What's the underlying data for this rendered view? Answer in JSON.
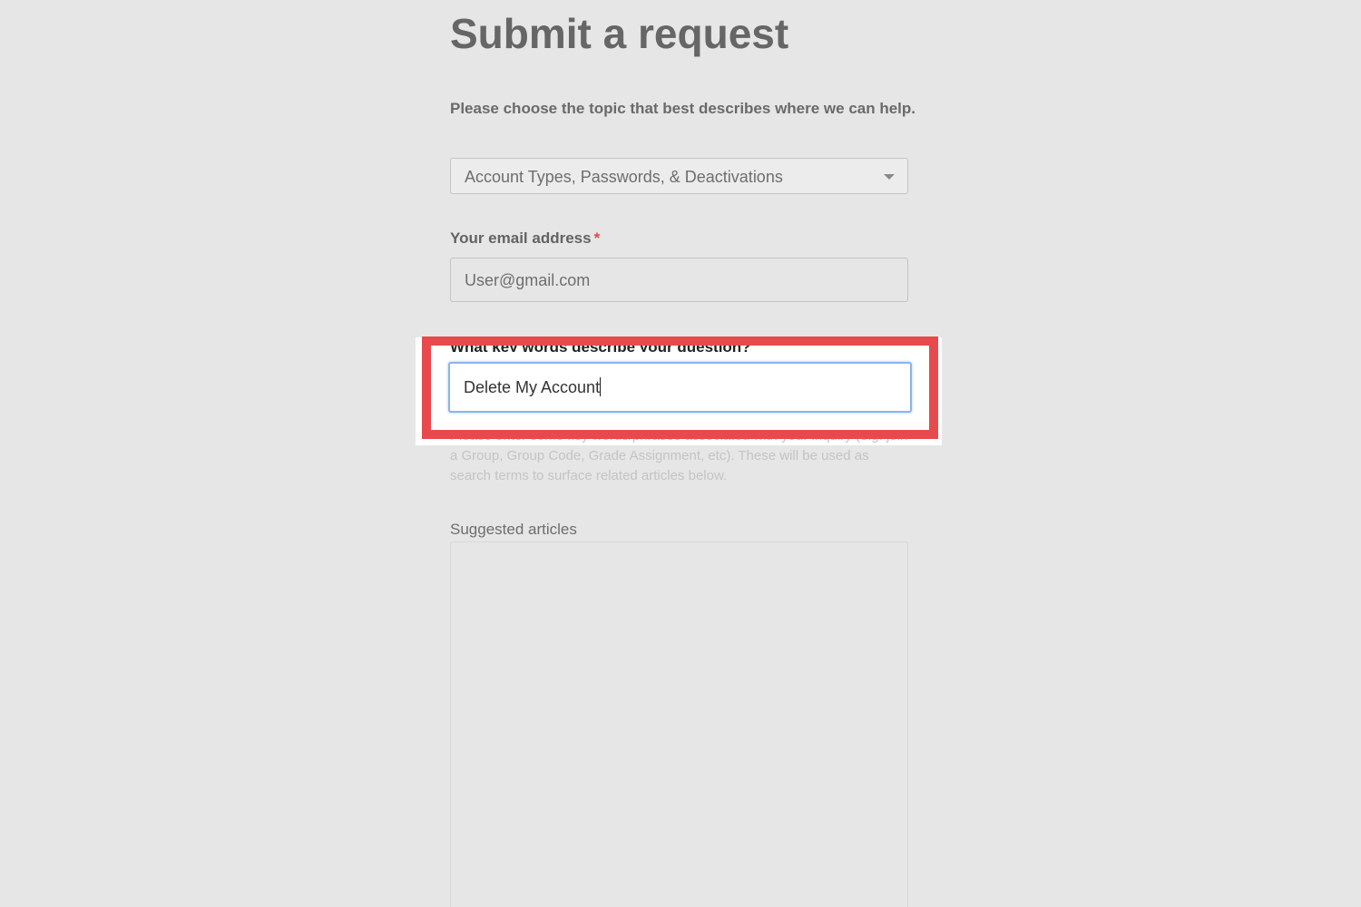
{
  "page": {
    "title": "Submit a request",
    "intro": "Please choose the topic that best describes where we can help."
  },
  "topic_select": {
    "selected": "Account Types, Passwords, & Deactivations"
  },
  "email": {
    "label": "Your email address",
    "required_mark": "*",
    "value": "User@gmail.com"
  },
  "keywords": {
    "label": "What key words describe your question?",
    "value": "Delete My Account",
    "hint": "Please enter some key words/phrases associated with your inquiry (e.g. join a Group, Group Code, Grade Assignment, etc). These will be used as search terms to surface related articles below."
  },
  "suggested": {
    "label": "Suggested articles"
  },
  "colors": {
    "highlight": "#e8494d",
    "focus_border": "#8cb4ea",
    "background": "#e6e6e6"
  }
}
